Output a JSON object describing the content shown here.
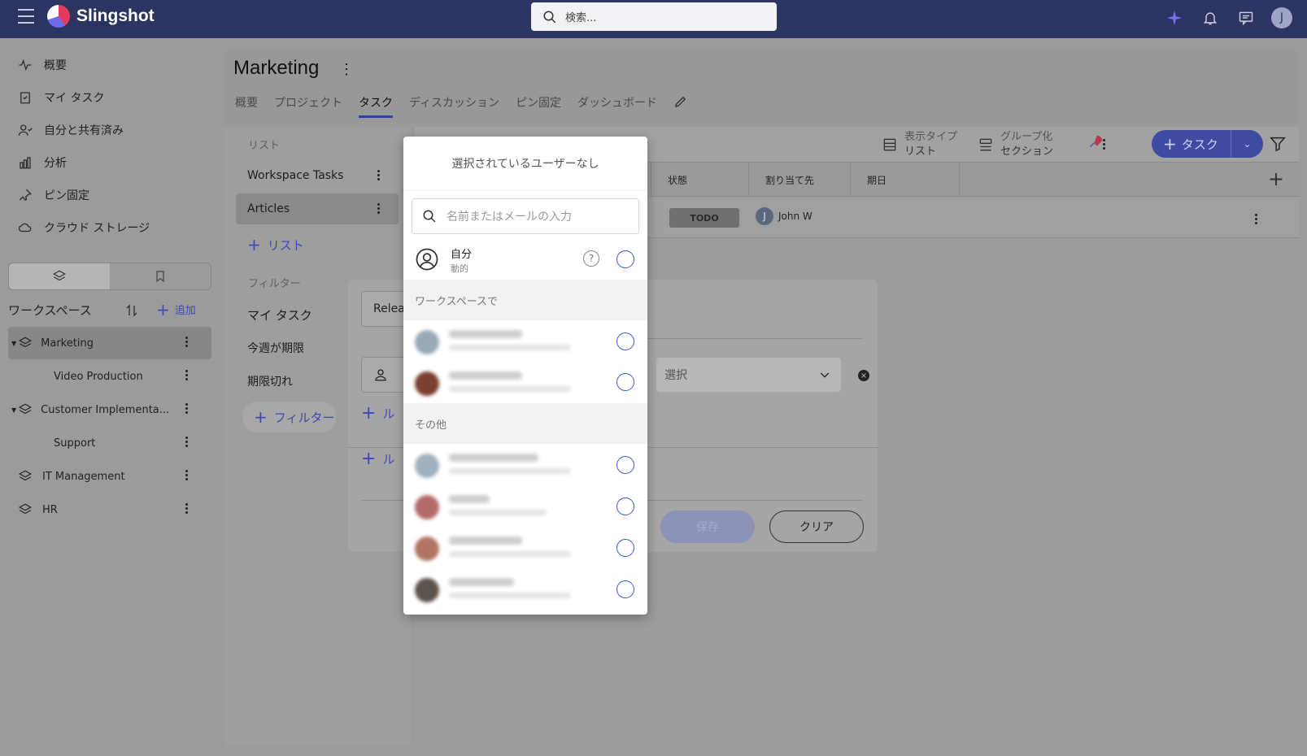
{
  "app": {
    "name": "Slingshot",
    "search_placeholder": "検索..."
  },
  "user": {
    "initial": "J"
  },
  "nav": [
    {
      "label": "概要",
      "icon": "activity-icon"
    },
    {
      "label": "マイ タスク",
      "icon": "clipboard-check-icon"
    },
    {
      "label": "自分と共有済み",
      "icon": "user-share-icon"
    },
    {
      "label": "分析",
      "icon": "bar-chart-icon"
    },
    {
      "label": "ピン固定",
      "icon": "pin-icon"
    },
    {
      "label": "クラウド ストレージ",
      "icon": "cloud-icon"
    }
  ],
  "workspaces": {
    "header": "ワークスペース",
    "add_label": "追加",
    "items": [
      {
        "label": "Marketing"
      },
      {
        "label": "Video Production"
      },
      {
        "label": "Customer Implementa..."
      },
      {
        "label": "Support"
      },
      {
        "label": "IT Management"
      },
      {
        "label": "HR"
      }
    ]
  },
  "page": {
    "title": "Marketing",
    "tabs": [
      "概要",
      "プロジェクト",
      "タスク",
      "ディスカッション",
      "ピン固定",
      "ダッシュボード"
    ]
  },
  "lists": {
    "header": "リスト",
    "items": [
      "Workspace Tasks",
      "Articles"
    ],
    "add_list": "リスト",
    "filter_header": "フィルター",
    "filters": [
      "マイ タスク",
      "今週が期限",
      "期限切れ"
    ],
    "add_filter": "フィルター"
  },
  "toolbar": {
    "view_type": "表示タイプ",
    "view_value": "リスト",
    "group": "グループ化",
    "group_value": "セクション",
    "task_button": "タスク"
  },
  "grid": {
    "columns": [
      "状態",
      "割り当て先",
      "期日"
    ],
    "row": {
      "status": "TODO",
      "assignee": "John W",
      "assignee_initial": "J"
    }
  },
  "filter_dialog": {
    "field_text": "Relea",
    "select_placeholder": "選択",
    "rule_label": "ル",
    "save_label": "保存",
    "clear_label": "クリア"
  },
  "popup": {
    "title": "選択されているユーザーなし",
    "search_placeholder": "名前またはメールの入力",
    "self_name": "自分",
    "self_sub": "動的",
    "section_workspace": "ワークスペースで",
    "section_other": "その他",
    "help_icon": "?"
  },
  "colors": {
    "header_bg": "#2c3561",
    "accent": "#3a5bd0",
    "radio": "#3a5bd0"
  }
}
